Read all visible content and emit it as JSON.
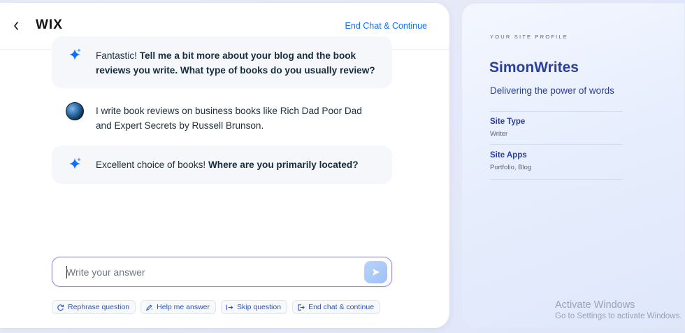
{
  "header": {
    "logo": "WIX",
    "end_chat_link": "End Chat & Continue"
  },
  "messages": [
    {
      "sender": "ai",
      "text_regular": "Fantastic! ",
      "text_bold": "Tell me a bit more about your blog and the book reviews you write. What type of books do you usually review?"
    },
    {
      "sender": "user",
      "text": "I write book reviews on business books like Rich Dad Poor Dad and Expert Secrets by Russell Brunson."
    },
    {
      "sender": "ai",
      "text_regular": "Excellent choice of books! ",
      "text_bold": "Where are you primarily located?"
    }
  ],
  "composer": {
    "placeholder": "Write your answer",
    "value": ""
  },
  "quick_actions": [
    {
      "label": "Rephrase question",
      "icon": "refresh-icon"
    },
    {
      "label": "Help me answer",
      "icon": "pencil-sparkle-icon"
    },
    {
      "label": "Skip question",
      "icon": "skip-arrow-icon"
    },
    {
      "label": "End chat & continue",
      "icon": "exit-icon"
    }
  ],
  "profile": {
    "eyebrow": "YOUR SITE PROFILE",
    "site_name": "SimonWrites",
    "tagline": "Delivering the power of words",
    "fields": [
      {
        "label": "Site Type",
        "value": "Writer"
      },
      {
        "label": "Site Apps",
        "value": "Portfolio, Blog"
      }
    ]
  },
  "watermark": {
    "line1": "Activate Windows",
    "line2": "Go to Settings to activate Windows."
  },
  "colors": {
    "accent": "#116dff",
    "profile_text": "#2b3fa0",
    "sparkle": "#116dff"
  }
}
